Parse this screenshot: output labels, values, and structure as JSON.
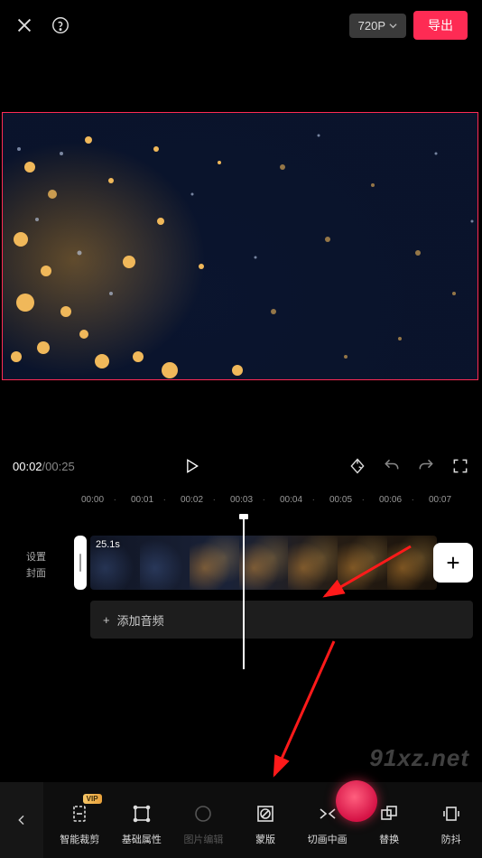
{
  "topbar": {
    "resolution_label": "720P",
    "export_label": "导出"
  },
  "playback": {
    "current": "00:02",
    "separator": " / ",
    "total": "00:25"
  },
  "ruler": [
    "00:00",
    "00:01",
    "00:02",
    "00:03",
    "00:04",
    "00:05",
    "00:06",
    "00:07"
  ],
  "tracks": {
    "cover_label_line1": "设置",
    "cover_label_line2": "封面",
    "clip_duration": "25.1s",
    "add_audio_label": "添加音频",
    "add_plus": "+"
  },
  "tools": {
    "back_icon": "chevron-left",
    "items": [
      {
        "id": "smart-crop",
        "label": "智能裁剪",
        "vip": true
      },
      {
        "id": "basic-attr",
        "label": "基础属性"
      },
      {
        "id": "image-edit",
        "label": "图片编辑",
        "disabled": true
      },
      {
        "id": "mask",
        "label": "蒙版"
      },
      {
        "id": "pip",
        "label": "切画中画"
      },
      {
        "id": "replace",
        "label": "替换"
      },
      {
        "id": "stabilize",
        "label": "防抖"
      }
    ],
    "vip_badge": "VIP"
  },
  "watermark": "91xz.net"
}
